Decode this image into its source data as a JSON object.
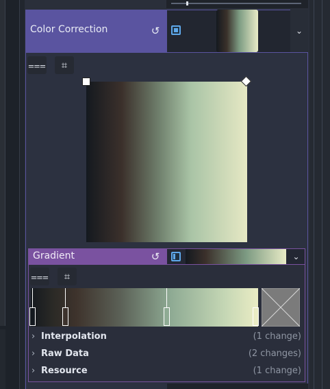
{
  "color_correction": {
    "label": "Color Correction",
    "reset_icon": "reset-icon",
    "type_icon": "texture-icon",
    "dropdown_icon": "chevron-down-icon"
  },
  "curve_editor": {
    "tools": [
      "curve-preset-icon",
      "grid-snap-icon"
    ]
  },
  "gradient": {
    "label": "Gradient",
    "reset_icon": "reset-icon",
    "type_icon": "gradient-resource-icon",
    "dropdown_icon": "chevron-down-icon",
    "tools": [
      "reverse-icon",
      "grid-snap-icon"
    ],
    "sections": [
      {
        "label": "Interpolation",
        "count": "(1 change)"
      },
      {
        "label": "Raw Data",
        "count": "(2 changes)"
      },
      {
        "label": "Resource",
        "count": "(1 change)"
      }
    ]
  },
  "colors": {
    "section_accent": "#5a54a0",
    "subresource_accent": "#7a52a0",
    "icon_accent": "#5fa8ea"
  }
}
